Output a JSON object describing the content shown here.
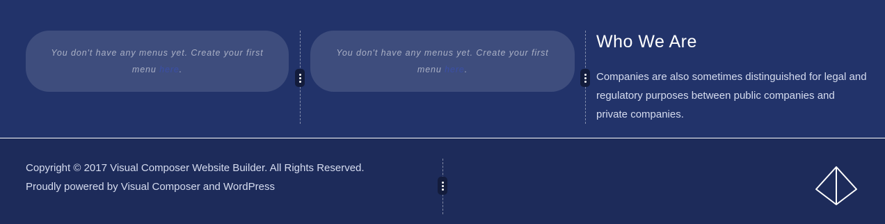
{
  "widget_menus": [
    {
      "text": "You don't have any menus yet. Create your first menu ",
      "link": "here",
      "suffix": "."
    },
    {
      "text": "You don't have any menus yet. Create your first menu ",
      "link": "here",
      "suffix": "."
    }
  ],
  "who_we_are": {
    "title": "Who We Are",
    "body": "Companies are also sometimes distinguished for legal and regulatory purposes between public companies and private companies."
  },
  "footer": {
    "copyright": "Copyright © 2017 Visual Composer Website Builder. All Rights Reserved.",
    "powered": "Proudly powered by Visual Composer and WordPress"
  },
  "icons": {
    "column_handle": "vertical-dots-icon",
    "logo": "diamond-logo-icon"
  },
  "colors": {
    "top_background": "#22336a",
    "footer_background": "#1d2b5a",
    "link": "#3b4fa6"
  }
}
